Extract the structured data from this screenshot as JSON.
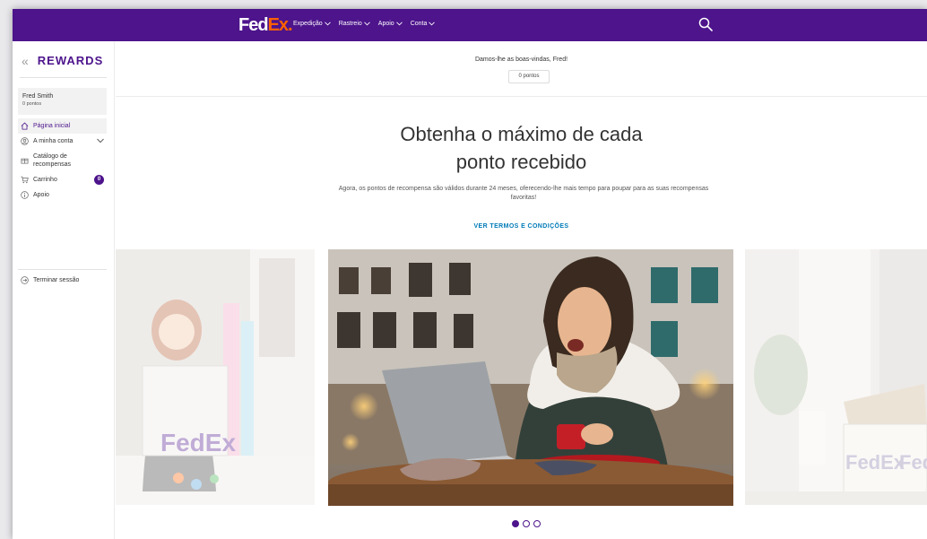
{
  "brand": {
    "logo_fed": "Fed",
    "logo_ex": "Ex",
    "logo_dot": ".",
    "primary": "#4d148c",
    "accent": "#ff6200",
    "link": "#007ab7"
  },
  "nav": {
    "items": [
      {
        "label": "Expedição"
      },
      {
        "label": "Rastreio"
      },
      {
        "label": "Apoio"
      },
      {
        "label": "Conta"
      }
    ],
    "search_icon": "search-icon"
  },
  "sidebar": {
    "title": "REWARDS",
    "user": {
      "name": "Fred Smith",
      "points": "0 pontos"
    },
    "menu": [
      {
        "label": "Página inicial",
        "icon": "home-icon"
      },
      {
        "label": "A minha conta",
        "icon": "account-icon"
      },
      {
        "label": "Catálogo de recompensas",
        "icon": "gift-icon"
      },
      {
        "label": "Carrinho",
        "icon": "cart-icon",
        "badge": "0"
      },
      {
        "label": "Apoio",
        "icon": "info-icon"
      }
    ],
    "logout": {
      "label": "Terminar sessão",
      "icon": "logout-icon"
    }
  },
  "main": {
    "welcome": "Damos-lhe as boas-vindas, Fred!",
    "points": "0 pontos",
    "hero_line1": "Obtenha o máximo de cada",
    "hero_line2": "ponto recebido",
    "description": "Agora, os pontos de recompensa são válidos durante 24 meses, oferecendo-lhe mais tempo para poupar para as suas recompensas favoritas!",
    "terms": "VER TERMOS E CONDIÇÕES",
    "carousel_watermark": "FedEx",
    "carousel_page_count": 3,
    "carousel_active": 1
  }
}
